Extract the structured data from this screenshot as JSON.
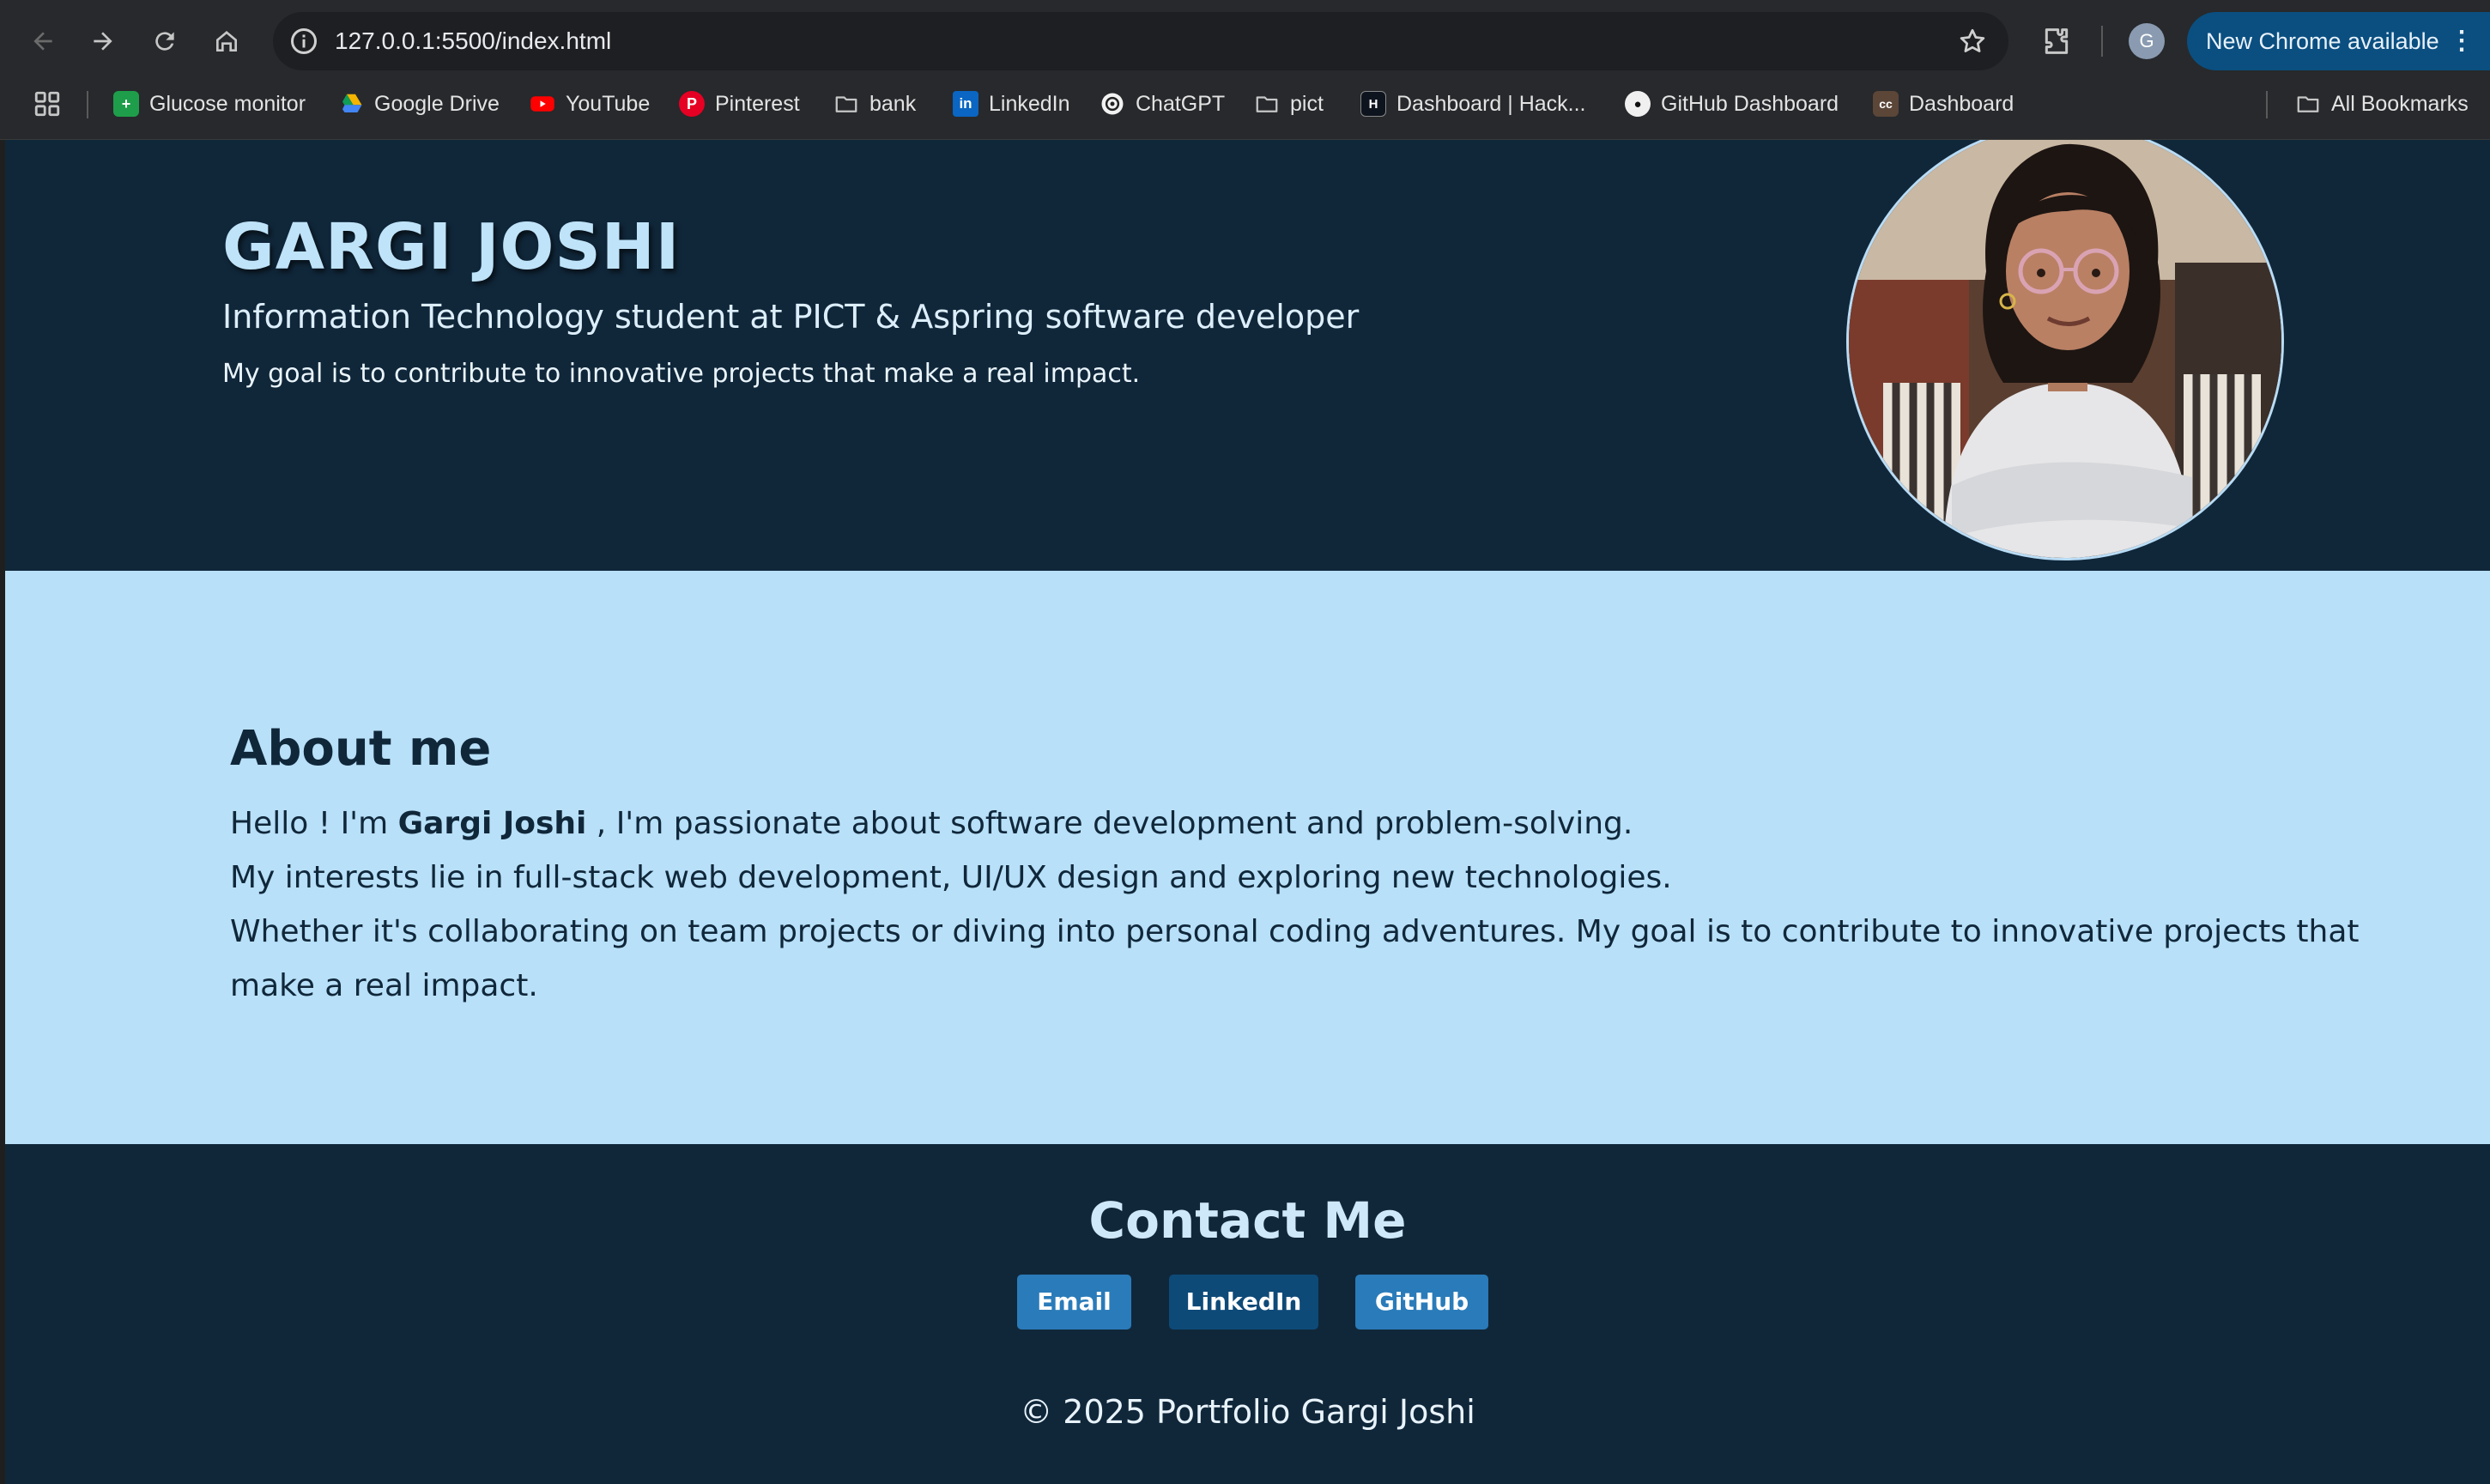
{
  "browser": {
    "url": "127.0.0.1:5500/index.html",
    "profile_initial": "G",
    "update_label": "New Chrome available",
    "update_menu_glyph": "⋮",
    "bookmarks": [
      {
        "label": "Glucose monitor",
        "icon": "glucose-monitor-icon"
      },
      {
        "label": "Google Drive",
        "icon": "google-drive-icon"
      },
      {
        "label": "YouTube",
        "icon": "youtube-icon"
      },
      {
        "label": "Pinterest",
        "icon": "pinterest-icon"
      },
      {
        "label": "bank",
        "icon": "folder-icon"
      },
      {
        "label": "LinkedIn",
        "icon": "linkedin-icon"
      },
      {
        "label": "ChatGPT",
        "icon": "chatgpt-icon"
      },
      {
        "label": "pict",
        "icon": "folder-icon"
      },
      {
        "label": "Dashboard | Hack...",
        "icon": "hackerrank-icon"
      },
      {
        "label": "GitHub Dashboard",
        "icon": "github-icon"
      },
      {
        "label": "Dashboard",
        "icon": "codechef-icon"
      }
    ],
    "all_bookmarks_label": "All Bookmarks"
  },
  "hero": {
    "name": "GARGI JOSHI",
    "subtitle": "Information Technology student at PICT & Aspring software developer",
    "goal": "My goal is to contribute to innovative projects that make a real impact."
  },
  "about": {
    "title": "About me",
    "line1_prefix": "Hello ! I'm ",
    "line1_name": "Gargi Joshi",
    "line1_suffix": " , I'm passionate about software development and problem-solving.",
    "line2": "My interests lie in full-stack web development, UI/UX design and exploring new technologies.",
    "line3": "Whether it's collaborating on team projects or diving into personal coding adventures. My goal is to contribute to innovative projects that make a real impact."
  },
  "contact": {
    "title": "Contact Me",
    "buttons": [
      {
        "label": "Email",
        "color": "#2a7bb9"
      },
      {
        "label": "LinkedIn",
        "color": "#0e4a78"
      },
      {
        "label": "GitHub",
        "color": "#2a7bb9"
      }
    ],
    "copyright": "© 2025 Portfolio Gargi Joshi"
  },
  "colors": {
    "hero_bg": "#10273a",
    "about_bg": "#b8e0f8",
    "name_color": "#bfe3f9"
  }
}
